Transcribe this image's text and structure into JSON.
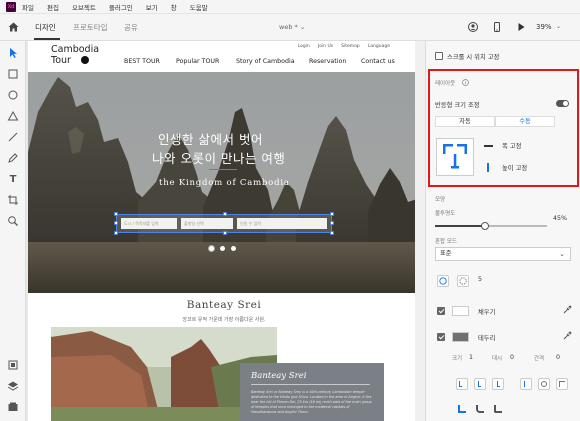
{
  "menubar": {
    "app_icon": "Xd",
    "items": [
      "파일",
      "편집",
      "오브젝트",
      "플러그인",
      "보기",
      "창",
      "도움말"
    ]
  },
  "toolbar": {
    "tabs": [
      "디자인",
      "프로토타입",
      "공유"
    ],
    "document": "web * ⌄",
    "zoom": "39%",
    "icons": [
      "home-icon",
      "user-icon",
      "mobile-preview-icon",
      "play-icon"
    ]
  },
  "left_tools": [
    "select-icon",
    "rectangle-icon",
    "ellipse-icon",
    "polygon-icon",
    "line-icon",
    "pen-icon",
    "text-icon",
    "artboard-icon",
    "zoom-icon",
    "plugins-icon",
    "layers-icon",
    "assets-icon"
  ],
  "site": {
    "logo_line1": "Cambodia",
    "logo_line2": "Tour",
    "top_links": [
      "Login",
      "Join Us",
      "Sitemap",
      "Language"
    ],
    "nav": [
      "BEST TOUR",
      "Popular TOUR",
      "Story of Cambodia",
      "Reservation",
      "Contact us"
    ],
    "hero_title1": "인생한 삶에서 벗어",
    "hero_title2": "나와 오롯이 만나는 여행",
    "hero_sub": "the Kingdom of Cambodia",
    "search_placeholders": [
      "도시 / 목적지를 입력",
      "출발일 선택",
      "인원 수 입력"
    ],
    "section_title": "Banteay Srei",
    "section_sub": "앙코르 유적 가운데 가장 아름다운 사원.",
    "card_title": "Banteay Srei",
    "card_text": "Banteay Srei or Banteay Srey is a 10th-century Cambodian temple dedicated to the Hindu god Shiva. Located in the area of Angkor, it lies near the hill of Phnom Dei, 25 km (16 mi) north-east of the main group of temples that once belonged to the medieval capitals of Yasodharapura and Angkor Thom."
  },
  "panel": {
    "scroll_fixed": "스크롤 시 위치 고정",
    "responsive_section": "레이아웃",
    "responsive_resize": "반응형 크기 조정",
    "responsive_on": true,
    "auto_label": "자동",
    "manual_label": "수동",
    "fix_width": "폭 고정",
    "fix_height": "높이 고정",
    "appearance": "모양",
    "opacity_label": "불투명도",
    "opacity_value": "45%",
    "opacity": 0.45,
    "blend_label": "혼합 모드",
    "blend_value": "표준",
    "corner_value": "5",
    "fill_label": "채우기",
    "border_label": "테두리",
    "size_label": "크기",
    "size_value": "1",
    "dash_label": "대시",
    "dash_value": "0",
    "gap_label": "간격",
    "gap_value": "0",
    "fill_color": "#ffffff",
    "border_color": "#707070"
  },
  "colors": {
    "accent": "#1473e6",
    "highlight_box": "#e01818",
    "selection": "#4a86e8"
  }
}
